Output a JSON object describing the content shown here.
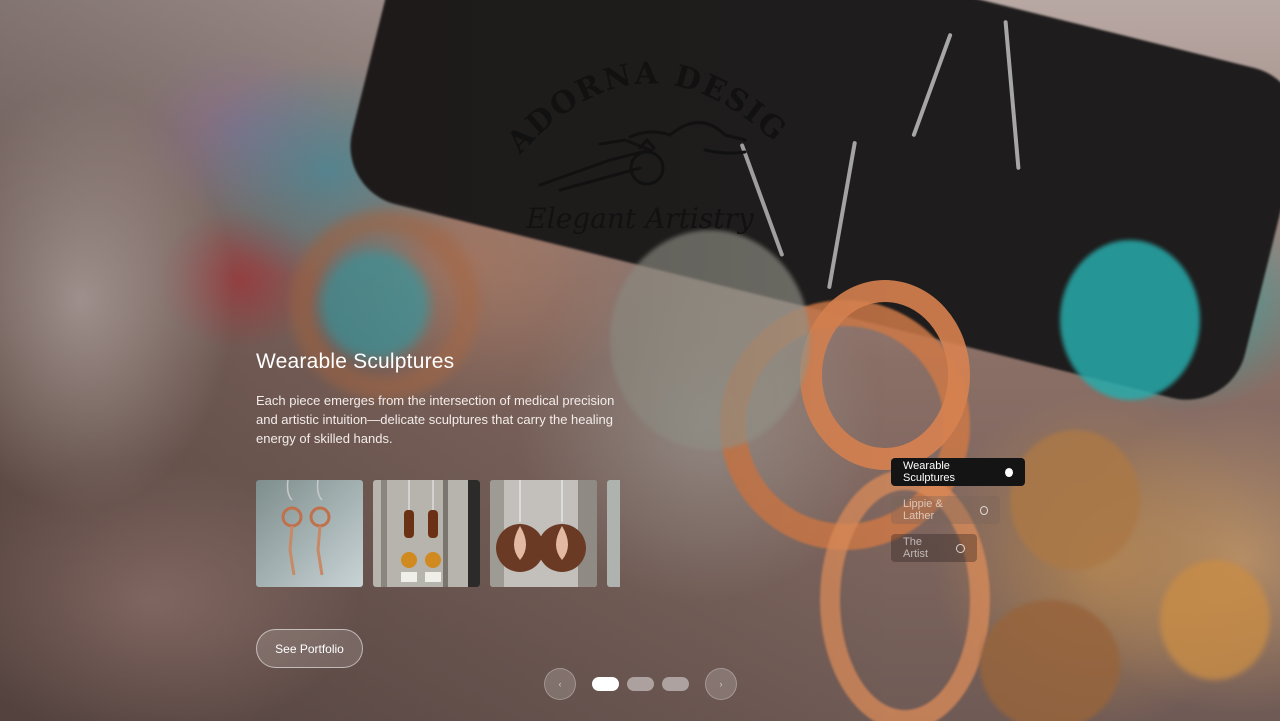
{
  "brand": {
    "name": "ADORNA DESIGN",
    "tagline": "Elegant Artistry"
  },
  "hero": {
    "title": "Wearable Sculptures",
    "description": "Each piece emerges from the intersection of medical precision and artistic intuition—delicate sculptures that carry the healing energy of skilled hands.",
    "cta_label": "See Portfolio"
  },
  "gallery": {
    "thumbnails": [
      {
        "subject": "copper-hoop-chain-earrings"
      },
      {
        "subject": "wood-bead-drop-earrings"
      },
      {
        "subject": "copper-disc-leaf-earrings"
      },
      {
        "subject": "partial-earring"
      }
    ]
  },
  "collection_nav": {
    "items": [
      {
        "label": "Wearable Sculptures",
        "active": true
      },
      {
        "label": "Lippie & Lather",
        "active": false
      },
      {
        "label": "The Artist",
        "active": false
      }
    ]
  },
  "slider": {
    "prev_icon": "‹",
    "next_icon": "›",
    "total_slides": 3,
    "current_slide": 1
  },
  "colors": {
    "nav_active_bg": "#141414",
    "text_primary": "#ffffff",
    "accent_copper": "#c8773f"
  }
}
